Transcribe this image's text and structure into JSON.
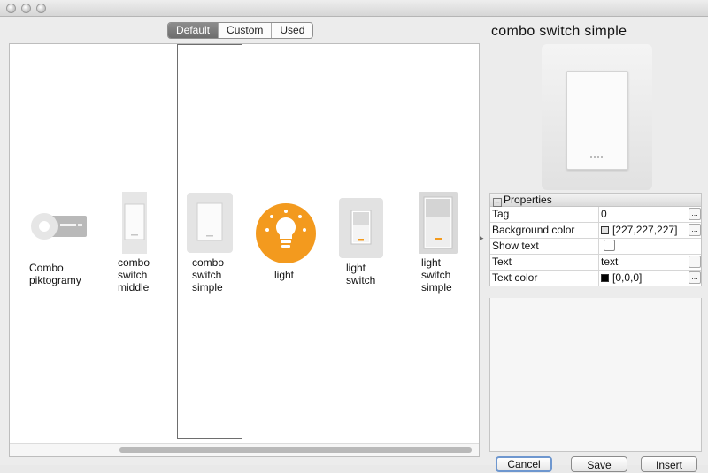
{
  "tabs": [
    {
      "label": "Default",
      "active": true
    },
    {
      "label": "Custom",
      "active": false
    },
    {
      "label": "Used",
      "active": false
    }
  ],
  "gallery": {
    "items": [
      {
        "label": "Combo\npiktogramy",
        "badge": "format",
        "icon": "combo-piktogramy-icon"
      },
      {
        "label": "combo\nswitch\nmiddle",
        "icon": "combo-switch-middle-icon"
      },
      {
        "label": "combo\nswitch\nsimple",
        "icon": "combo-switch-simple-icon",
        "selected": true
      },
      {
        "label": "light",
        "icon": "light-bulb-icon"
      },
      {
        "label": "light\nswitch",
        "icon": "light-switch-icon"
      },
      {
        "label": "light\nswitch\nsimple",
        "icon": "light-switch-simple-icon"
      }
    ]
  },
  "preview": {
    "title": "combo switch simple"
  },
  "properties": {
    "header": "Properties",
    "rows": [
      {
        "name": "Tag",
        "value": "0",
        "has_button": true
      },
      {
        "name": "Background color",
        "value": "[227,227,227]",
        "swatch": "#e3e3e3",
        "has_button": true
      },
      {
        "name": "Show text",
        "value": "",
        "checkbox": true,
        "has_button": false
      },
      {
        "name": "Text",
        "value": "text",
        "has_button": true
      },
      {
        "name": "Text color",
        "value": "[0,0,0]",
        "swatch": "#000000",
        "has_button": true
      }
    ],
    "button_label": "..."
  },
  "buttons": {
    "cancel": "Cancel",
    "save": "Save",
    "insert": "Insert"
  },
  "colors": {
    "accent_orange": "#f39a1e",
    "tab_active": "#7a7a7a",
    "focus_ring": "#6e97cf"
  }
}
